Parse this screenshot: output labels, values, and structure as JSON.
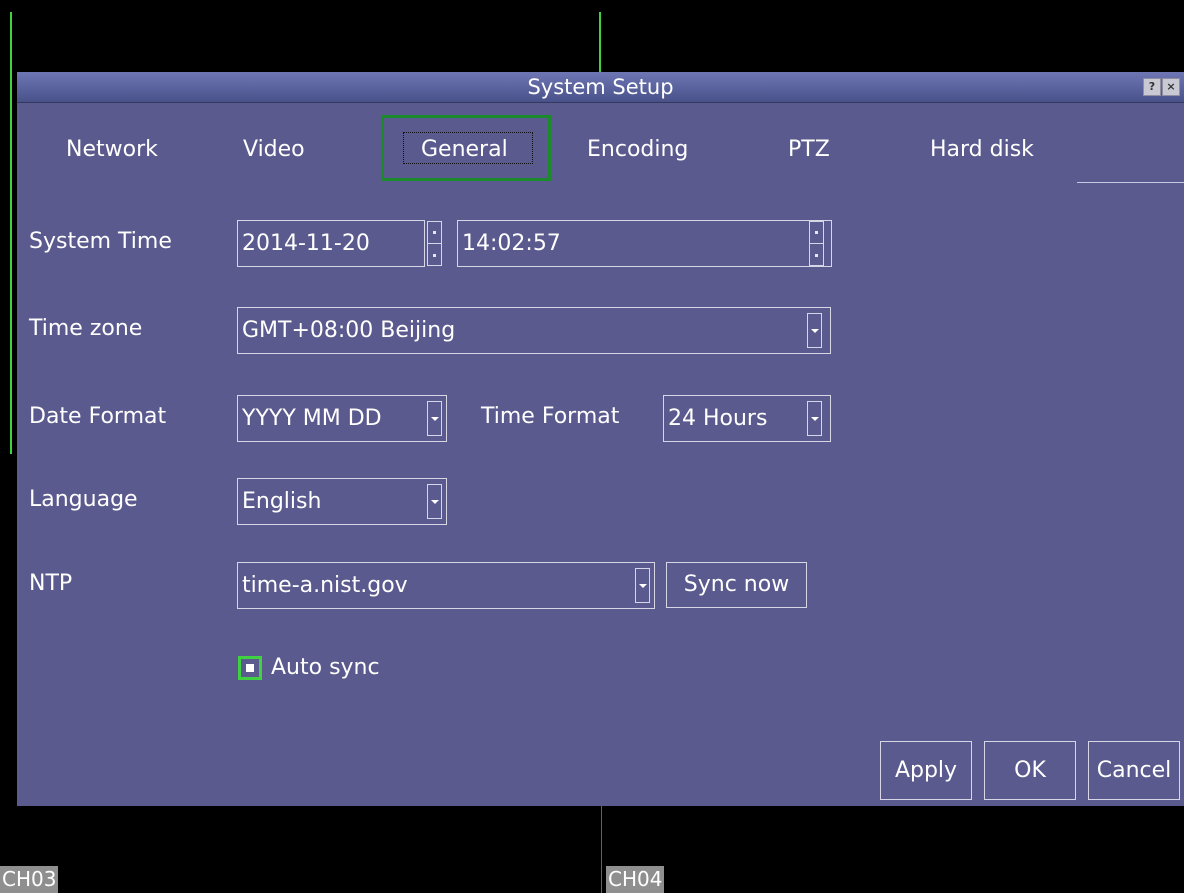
{
  "dialog": {
    "title": "System Setup",
    "help_label": "?",
    "close_label": "×",
    "tabs": [
      {
        "label": "Network"
      },
      {
        "label": "Video"
      },
      {
        "label": "General"
      },
      {
        "label": "Encoding"
      },
      {
        "label": "PTZ"
      },
      {
        "label": "Hard disk"
      }
    ],
    "active_tab": "General"
  },
  "form": {
    "system_time": {
      "label": "System Time",
      "date": "2014-11-20",
      "time": "14:02:57"
    },
    "time_zone": {
      "label": "Time zone",
      "value": "GMT+08:00 Beijing"
    },
    "date_format": {
      "label": "Date Format",
      "value": "YYYY MM DD"
    },
    "time_format": {
      "label": "Time Format",
      "value": "24 Hours"
    },
    "language": {
      "label": "Language",
      "value": "English"
    },
    "ntp": {
      "label": "NTP",
      "server": "time-a.nist.gov",
      "sync_button": "Sync now"
    },
    "auto_sync": {
      "label": "Auto sync",
      "checked": true
    }
  },
  "buttons": {
    "apply": "Apply",
    "ok": "OK",
    "cancel": "Cancel"
  },
  "channels": {
    "ch03": "CH03",
    "ch04": "CH04"
  },
  "colors": {
    "dialog_bg": "#5b5a8e",
    "highlight": "#1a8a2a",
    "check_accent": "#3fd13f"
  }
}
